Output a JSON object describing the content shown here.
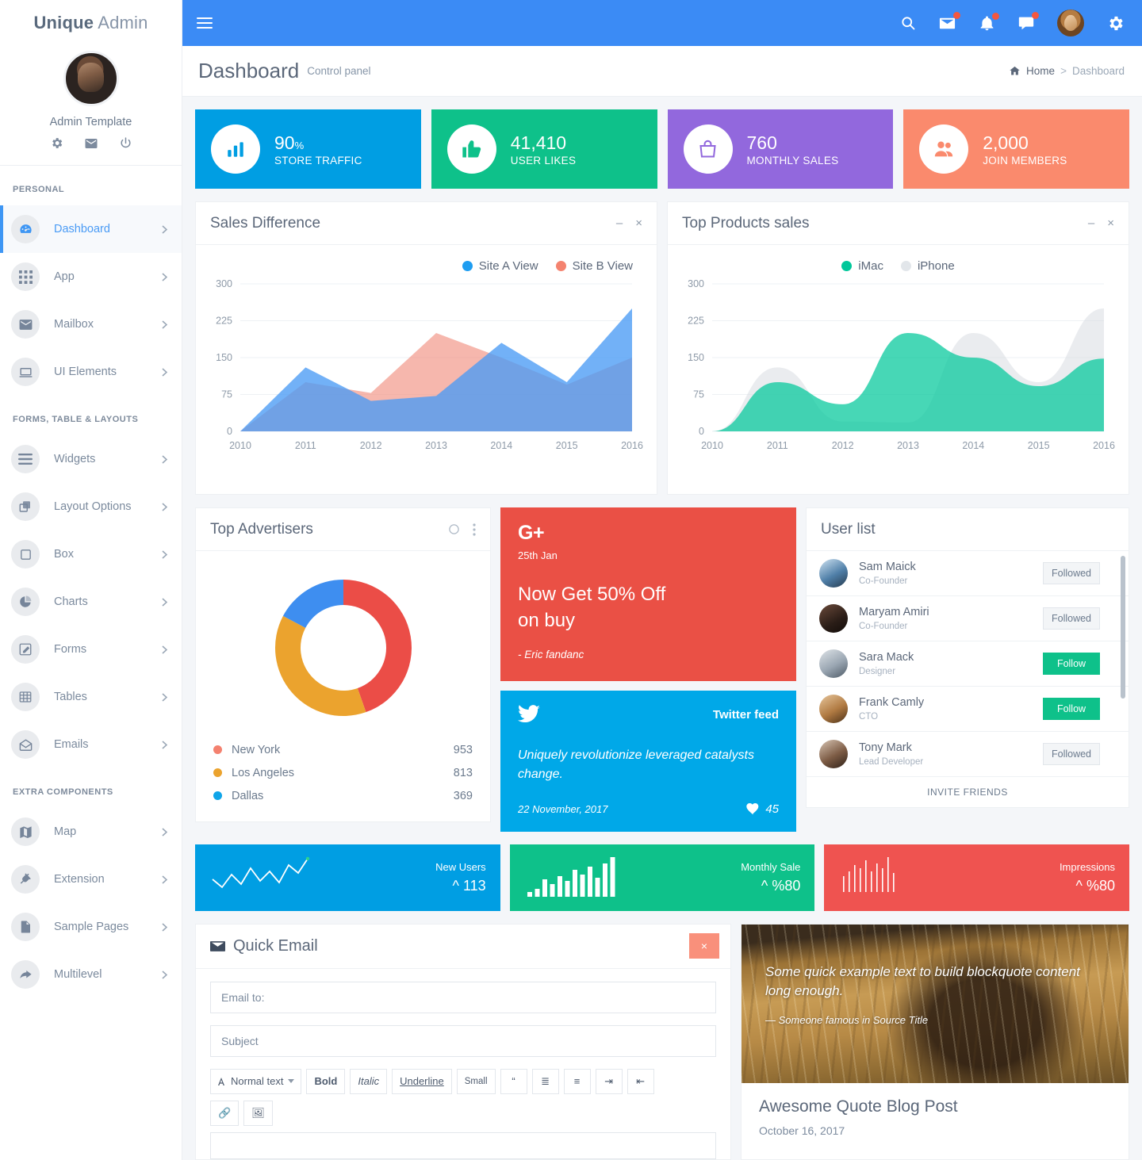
{
  "brand": {
    "bold": "Unique",
    "light": "Admin"
  },
  "profile": {
    "name": "Admin Template",
    "icons": [
      "gear-icon",
      "envelope-icon",
      "power-icon"
    ]
  },
  "sidebar": {
    "sections": [
      {
        "title": "PERSONAL",
        "items": [
          {
            "label": "Dashboard",
            "icon": "dashboard-icon",
            "active": true
          },
          {
            "label": "App",
            "icon": "grid-icon",
            "active": false
          },
          {
            "label": "Mailbox",
            "icon": "envelope-icon",
            "active": false
          },
          {
            "label": "UI Elements",
            "icon": "laptop-icon",
            "active": false
          }
        ]
      },
      {
        "title": "FORMS, TABLE & LAYOUTS",
        "items": [
          {
            "label": "Widgets",
            "icon": "bars-icon",
            "active": false
          },
          {
            "label": "Layout Options",
            "icon": "clone-icon",
            "active": false
          },
          {
            "label": "Box",
            "icon": "square-icon",
            "active": false
          },
          {
            "label": "Charts",
            "icon": "pie-chart-icon",
            "active": false
          },
          {
            "label": "Forms",
            "icon": "edit-icon",
            "active": false
          },
          {
            "label": "Tables",
            "icon": "table-icon",
            "active": false
          },
          {
            "label": "Emails",
            "icon": "open-envelope-icon",
            "active": false
          }
        ]
      },
      {
        "title": "EXTRA COMPONENTS",
        "items": [
          {
            "label": "Map",
            "icon": "map-icon",
            "active": false
          },
          {
            "label": "Extension",
            "icon": "plug-icon",
            "active": false
          },
          {
            "label": "Sample Pages",
            "icon": "file-icon",
            "active": false
          },
          {
            "label": "Multilevel",
            "icon": "share-arrow-icon",
            "active": false
          }
        ]
      }
    ]
  },
  "topbar": {
    "menu_icon": "hamburger-icon",
    "icons": [
      "search-icon",
      "mail-icon",
      "bell-icon",
      "chat-icon"
    ],
    "badges": [
      false,
      true,
      true,
      true
    ],
    "settings_icon": "gear-icon"
  },
  "pagehead": {
    "title": "Dashboard",
    "subtitle": "Control panel",
    "breadcrumb": {
      "home": "Home",
      "separator": ">",
      "current": "Dashboard"
    }
  },
  "stats": [
    {
      "value": "90",
      "suffix": "%",
      "label": "STORE TRAFFIC",
      "color": "#009ee3",
      "icon": "bar-chart-icon"
    },
    {
      "value": "41,410",
      "suffix": "",
      "label": "USER LIKES",
      "color": "#0ec18a",
      "icon": "thumbs-up-icon"
    },
    {
      "value": "760",
      "suffix": "",
      "label": "MONTHLY SALES",
      "color": "#9268dd",
      "icon": "bag-icon"
    },
    {
      "value": "2,000",
      "suffix": "",
      "label": "JOIN MEMBERS",
      "color": "#fa8a6d",
      "icon": "users-icon"
    }
  ],
  "sales_card": {
    "title": "Sales Difference",
    "minimize": "–",
    "close": "×"
  },
  "products_card": {
    "title": "Top Products sales",
    "minimize": "–",
    "close": "×"
  },
  "advertisers_card": {
    "title": "Top Advertisers",
    "refresh_icon": "circle-icon",
    "menu_icon": "vertical-dots-icon"
  },
  "promo": {
    "logo": "G+",
    "date": "25th Jan",
    "line1": "Now Get 50% Off",
    "line2": "on buy",
    "author": "- Eric fandanc",
    "color": "#ea5045"
  },
  "tweet": {
    "icon": "twitter-icon",
    "title": "Twitter feed",
    "body": "Uniquely revolutionize leveraged catalysts change.",
    "date": "22 November, 2017",
    "likes": "45",
    "heart_icon": "heart-icon",
    "color": "#00a8e8"
  },
  "userlist": {
    "title": "User list",
    "footer": "INVITE FRIENDS",
    "users": [
      {
        "name": "Sam Maick",
        "role": "Co-Founder",
        "action": "Followed",
        "followed": true
      },
      {
        "name": "Maryam Amiri",
        "role": "Co-Founder",
        "action": "Followed",
        "followed": true
      },
      {
        "name": "Sara Mack",
        "role": "Designer",
        "action": "Follow",
        "followed": false
      },
      {
        "name": "Frank Camly",
        "role": "CTO",
        "action": "Follow",
        "followed": false
      },
      {
        "name": "Tony Mark",
        "role": "Lead Developer",
        "action": "Followed",
        "followed": true
      }
    ]
  },
  "sparks": [
    {
      "label": "New Users",
      "value": "113",
      "caret": "^",
      "color": "#009ee3",
      "type": "line"
    },
    {
      "label": "Monthly Sale",
      "value": "%80",
      "caret": "^",
      "color": "#0ec18a",
      "type": "bar"
    },
    {
      "label": "Impressions",
      "value": "%80",
      "caret": "^",
      "color": "#ef5350",
      "type": "thinbar"
    }
  ],
  "quick_email": {
    "title": "Quick Email",
    "title_icon": "envelope-icon",
    "close": "×",
    "email_placeholder": "Email to:",
    "subject_placeholder": "Subject",
    "toolbar": [
      {
        "label": "Normal text",
        "name": "text-style-select",
        "kind": "select"
      },
      {
        "label": "Bold",
        "name": "bold-button",
        "kind": "bold"
      },
      {
        "label": "Italic",
        "name": "italic-button",
        "kind": "ital"
      },
      {
        "label": "Underline",
        "name": "underline-button",
        "kind": "und"
      },
      {
        "label": "Small",
        "name": "small-button",
        "kind": "small"
      },
      {
        "label": "“",
        "name": "blockquote-button",
        "kind": "icon"
      },
      {
        "label": "≣",
        "name": "unordered-list-button",
        "kind": "icon"
      },
      {
        "label": "≡",
        "name": "ordered-list-button",
        "kind": "icon"
      },
      {
        "label": "⇥",
        "name": "outdent-button",
        "kind": "icon"
      },
      {
        "label": "⇤",
        "name": "indent-button",
        "kind": "icon"
      }
    ],
    "toolbar2": [
      {
        "label": "🔗",
        "name": "link-button"
      },
      {
        "label": "🖼",
        "name": "image-button"
      }
    ]
  },
  "blog": {
    "quote": "Some quick example text to build blockquote content long enough.",
    "source": "— Someone famous in Source Title",
    "title": "Awesome Quote Blog Post",
    "date": "October 16, 2017"
  },
  "chart_data": [
    {
      "id": "sales-difference",
      "type": "area",
      "title": "Sales Difference",
      "categories": [
        "2010",
        "2011",
        "2012",
        "2013",
        "2014",
        "2015",
        "2016"
      ],
      "series": [
        {
          "name": "Site A View",
          "color": "#4a9bf5",
          "values": [
            0,
            130,
            62,
            72,
            180,
            100,
            250
          ]
        },
        {
          "name": "Site B View",
          "color": "#f08a7a",
          "values": [
            0,
            100,
            78,
            200,
            150,
            95,
            150
          ]
        }
      ],
      "ylim": [
        0,
        300
      ],
      "yticks": [
        0,
        75,
        150,
        225,
        300
      ],
      "xlabel": "",
      "ylabel": "",
      "grid": true,
      "legend": "top-right"
    },
    {
      "id": "top-products-sales",
      "type": "area",
      "title": "Top Products sales",
      "categories": [
        "2010",
        "2011",
        "2012",
        "2013",
        "2014",
        "2015",
        "2016"
      ],
      "series": [
        {
          "name": "iMac",
          "color": "#00c79a",
          "values": [
            0,
            100,
            55,
            200,
            150,
            92,
            148
          ]
        },
        {
          "name": "iPhone",
          "color": "#d9dde1",
          "values": [
            0,
            130,
            20,
            18,
            200,
            100,
            250
          ]
        }
      ],
      "ylim": [
        0,
        300
      ],
      "yticks": [
        0,
        75,
        150,
        225,
        300
      ],
      "xlabel": "",
      "ylabel": "",
      "grid": true,
      "legend": "top-center"
    },
    {
      "id": "top-advertisers",
      "type": "pie",
      "title": "Top Advertisers",
      "categories": [
        "New York",
        "Los Angeles",
        "Dallas"
      ],
      "values": [
        953,
        813,
        369
      ],
      "colors": [
        "#eb4d47",
        "#eba32e",
        "#3e8ef0"
      ],
      "legend_colors": [
        "#f4816f",
        "#eba32e",
        "#0fa5e9"
      ],
      "donut": true
    }
  ]
}
